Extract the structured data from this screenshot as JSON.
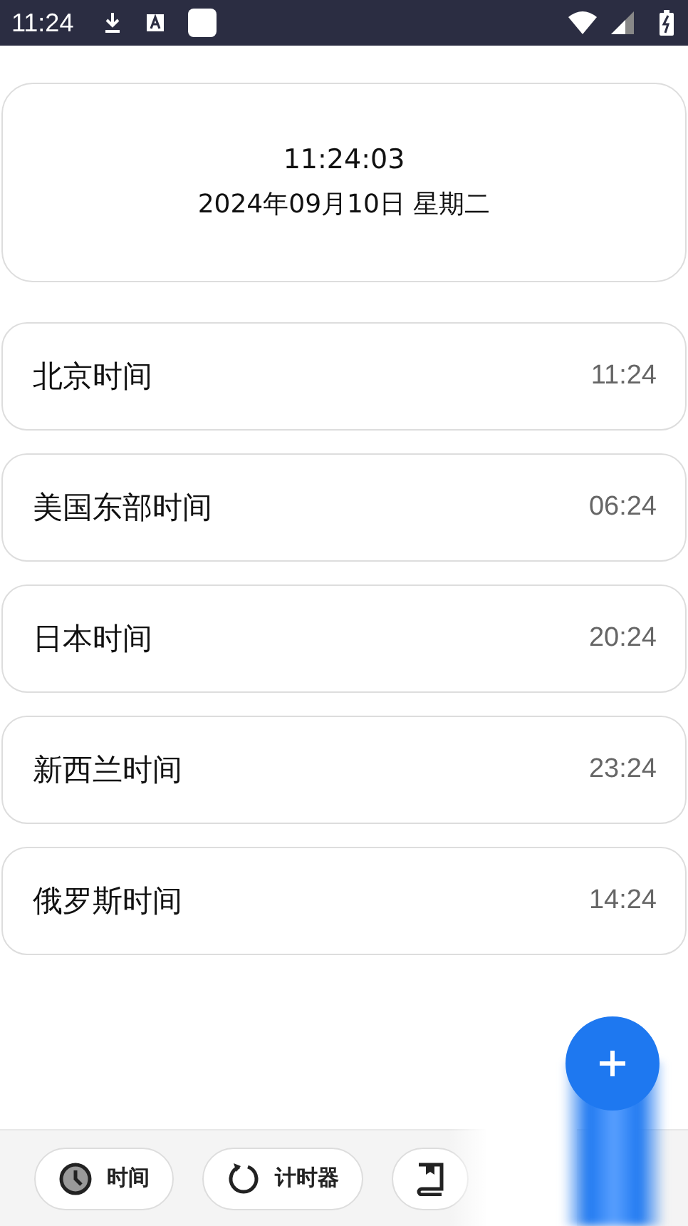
{
  "status_bar": {
    "time": "11:24"
  },
  "clock": {
    "time": "11:24:03",
    "date": "2024年09月10日 星期二"
  },
  "zones": [
    {
      "name": "北京时间",
      "time": "11:24"
    },
    {
      "name": "美国东部时间",
      "time": "06:24"
    },
    {
      "name": "日本时间",
      "time": "20:24"
    },
    {
      "name": "新西兰时间",
      "time": "23:24"
    },
    {
      "name": "俄罗斯时间",
      "time": "14:24"
    }
  ],
  "nav": [
    {
      "kind": "clock",
      "label": "时间"
    },
    {
      "kind": "timer",
      "label": "计时器"
    },
    {
      "kind": "book"
    }
  ]
}
